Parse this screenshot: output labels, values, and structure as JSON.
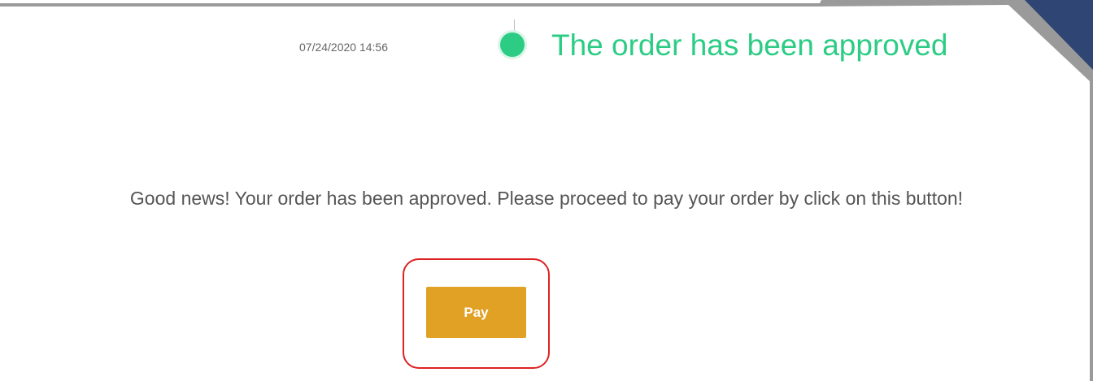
{
  "order": {
    "timestamp": "07/24/2020 14:56",
    "status_text": "The order has been approved",
    "status_color": "#2ccc84",
    "message": "Good news! Your order has been approved. Please proceed to pay your order by click on this button!"
  },
  "actions": {
    "pay_label": "Pay",
    "pay_color": "#e0a124"
  },
  "annotation": {
    "highlight_color": "#dd2222"
  },
  "decor": {
    "navy": "#2f4573",
    "gold": "#d4a02e"
  }
}
